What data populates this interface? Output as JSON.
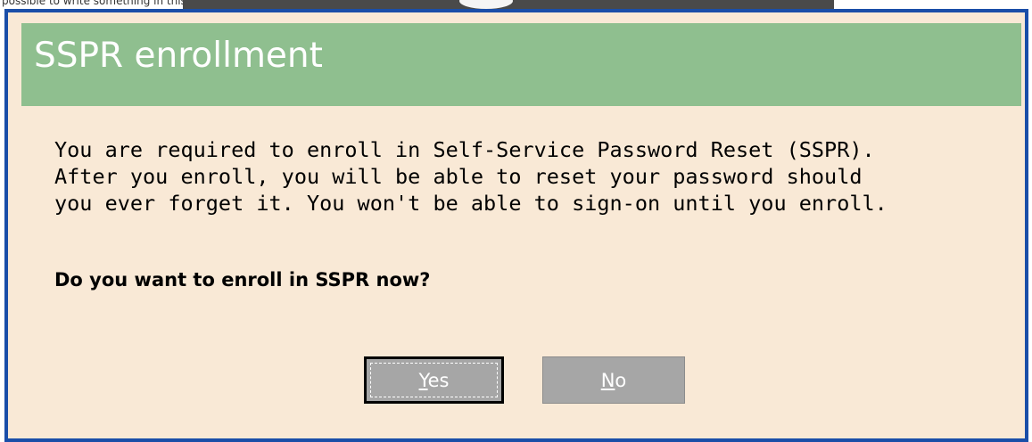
{
  "backdrop": {
    "text": "possible to write something in this place"
  },
  "dialog": {
    "title": "SSPR enrollment",
    "message_lines": [
      "You are required to enroll in Self-Service Password Reset (SSPR).",
      "After you enroll, you will be able to reset your password should",
      "you ever forget it. You won't be able to sign-on until you enroll."
    ],
    "question": "Do you want to enroll in SSPR now?",
    "buttons": {
      "yes": {
        "mnemonic": "Y",
        "rest": "es"
      },
      "no": {
        "mnemonic": "N",
        "rest": "o"
      }
    }
  },
  "colors": {
    "frame": "#1a4ea8",
    "title_bar": "#8fbf8f",
    "body_bg": "#f9e9d6",
    "button": "#a6a6a6"
  }
}
